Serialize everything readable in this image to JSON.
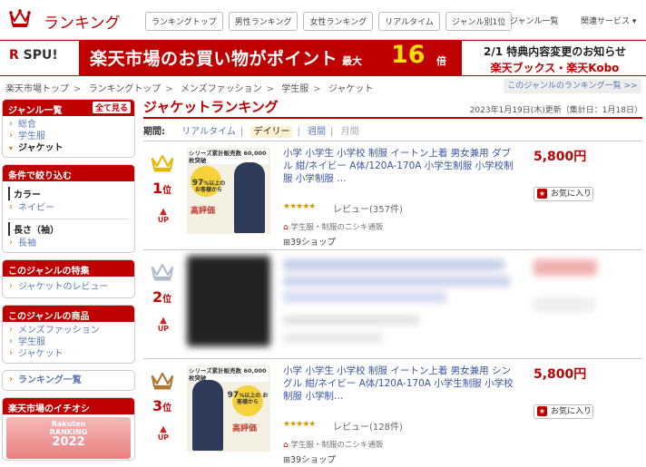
{
  "header": {
    "logo_text": "ランキング",
    "nav": [
      "ランキングトップ",
      "男性ランキング",
      "女性ランキング",
      "リアルタイム",
      "ジャンル別1位"
    ],
    "genre_list": "ジャンル一覧",
    "related_services": "関連サービス ▾"
  },
  "banner": {
    "spu_r": "R",
    "spu_text": "SPU!",
    "main_text": "楽天市場のお買い物がポイント",
    "max_text": "最大",
    "max_number": "16",
    "multiplier": "倍",
    "right_line1": "2/1 特典内容変更のお知らせ",
    "right_line2": "楽天ブックス・楽天Kobo"
  },
  "breadcrumb": [
    "楽天市場トップ",
    "ランキングトップ",
    "メンズファッション",
    "学生服",
    "ジャケット"
  ],
  "breadcrumb_sep": ">",
  "genre_ranking_link": "このジャンルのランキング一覧 >>",
  "sidebar": {
    "genre_list": {
      "title": "ジャンル一覧",
      "see_all": "全て見る",
      "items": [
        "総合",
        "学生服"
      ],
      "current": "ジャケット"
    },
    "filter": {
      "title": "条件で絞り込む",
      "color_label": "カラー",
      "color_value": "ネイビー",
      "sleeve_label": "長さ（袖）",
      "sleeve_value": "長袖"
    },
    "features": {
      "title": "このジャンルの特集",
      "items": [
        "ジャケットのレビュー"
      ]
    },
    "products": {
      "title": "このジャンルの商品",
      "items": [
        "メンズファッション",
        "学生服",
        "ジャケット"
      ]
    },
    "ranking_list": "ランキング一覧",
    "recommend": {
      "title": "楽天市場のイチオシ",
      "badge_line1": "Rakuten",
      "badge_line2": "RANKING",
      "badge_year": "2022"
    }
  },
  "main": {
    "title": "ジャケットランキング",
    "date": "2023年1月19日(木)更新（集計日：1月18日）",
    "period_label": "期間:",
    "periods": [
      "リアルタイム",
      "デイリー",
      "週間",
      "月間"
    ],
    "items": [
      {
        "rank": "1",
        "rank_suffix": "位",
        "trend": "UP",
        "title": "小学 小学生 小学校 制服 イートン上着 男女兼用 ダブル 紺/ネイビー A体/120A-170A 小学生制服 小学校制服 小学制服 …",
        "price": "5,800円",
        "favorite": "お気に入り",
        "stars": "★★★★★",
        "reviews": "レビュー(357件)",
        "shop": "学生服・制服のニシキ通販",
        "shop_count": "39ショップ",
        "thumb_badge": "シリーズ累計販売数 60,000枚突破",
        "thumb_circle_big": "97",
        "thumb_circle_pct": "%",
        "thumb_circle_text": "以上の お客様から",
        "thumb_eval": "高評価"
      },
      {
        "rank": "2",
        "rank_suffix": "位",
        "trend": "UP"
      },
      {
        "rank": "3",
        "rank_suffix": "位",
        "trend": "UP",
        "title": "小学 小学生 小学校 制服 イートン上着 男女兼用 シングル 紺/ネイビー A体/120A-170A 小学生制服 小学校制服 小学制…",
        "price": "5,800円",
        "favorite": "お気に入り",
        "stars": "★★★★★",
        "reviews": "レビュー(128件)",
        "shop": "学生服・制服のニシキ通販",
        "shop_count": "39ショップ",
        "thumb_badge": "シリーズ累計販売数 60,000枚突破",
        "thumb_circle_big": "97",
        "thumb_circle_pct": "%",
        "thumb_circle_text": "以上の お客様から",
        "thumb_eval": "高評価"
      }
    ]
  },
  "colors": {
    "brand_red": "#bf0000",
    "link_blue": "#3a55a8",
    "gold": "#e8b800",
    "silver": "#b0bccb",
    "bronze": "#b07830"
  }
}
